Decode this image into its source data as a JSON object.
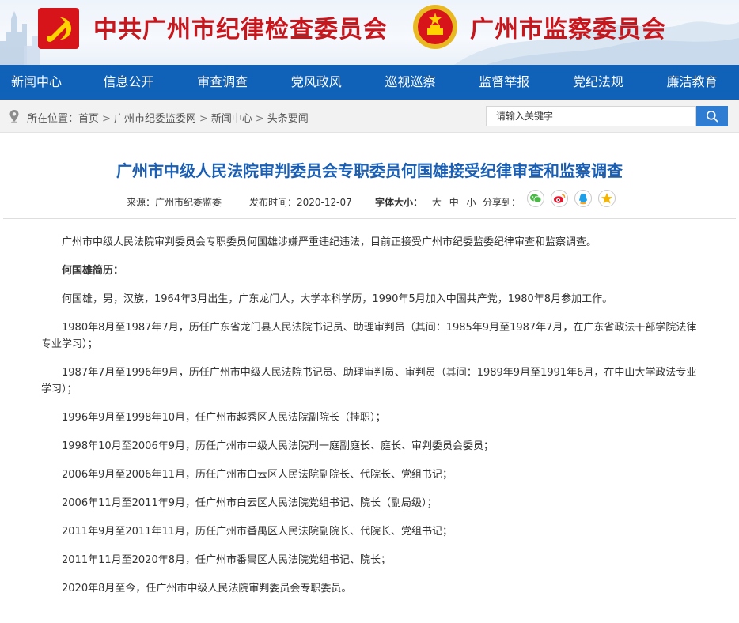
{
  "header": {
    "title_left": "中共广州市纪律检查委员会",
    "title_right": "广州市监察委员会",
    "brand_color": "#c8161d"
  },
  "nav": {
    "items": [
      "新闻中心",
      "信息公开",
      "审查调查",
      "党风政风",
      "巡视巡察",
      "监督举报",
      "党纪法规",
      "廉洁教育"
    ],
    "color": "#1062b8"
  },
  "location": {
    "label": "所在位置：",
    "crumbs": [
      "首页",
      "广州市纪委监委网",
      "新闻中心",
      "头条要闻"
    ],
    "separator": ">"
  },
  "search": {
    "placeholder": "请输入关键字"
  },
  "article": {
    "title": "广州市中级人民法院审判委员会专职委员何国雄接受纪律审查和监察调查",
    "source_label": "来源：",
    "source": "广州市纪委监委",
    "date_label": "发布时间：",
    "date": "2020-12-07",
    "font_size_label": "字体大小：",
    "font_sizes": [
      "大",
      "中",
      "小"
    ],
    "share_label": "分享到：",
    "share_icons": [
      "wechat-icon",
      "weibo-icon",
      "qq-icon",
      "qzone-icon"
    ],
    "paragraphs": [
      "广州市中级人民法院审判委员会专职委员何国雄涉嫌严重违纪违法，目前正接受广州市纪委监委纪律审查和监察调查。",
      "何国雄简历：",
      "何国雄，男，汉族，1964年3月出生，广东龙门人，大学本科学历，1990年5月加入中国共产党，1980年8月参加工作。",
      "1980年8月至1987年7月，历任广东省龙门县人民法院书记员、助理审判员（其间：1985年9月至1987年7月，在广东省政法干部学院法律专业学习）；",
      "1987年7月至1996年9月，历任广州市中级人民法院书记员、助理审判员、审判员（其间：1989年9月至1991年6月，在中山大学政法专业学习）；",
      "1996年9月至1998年10月，任广州市越秀区人民法院副院长（挂职）；",
      "1998年10月至2006年9月，历任广州市中级人民法院刑一庭副庭长、庭长、审判委员会委员；",
      "2006年9月至2006年11月，历任广州市白云区人民法院副院长、代院长、党组书记；",
      "2006年11月至2011年9月，任广州市白云区人民法院党组书记、院长（副局级）；",
      "2011年9月至2011年11月，历任广州市番禺区人民法院副院长、代院长、党组书记；",
      "2011年11月至2020年8月，任广州市番禺区人民法院党组书记、院长；",
      "2020年8月至今，任广州市中级人民法院审判委员会专职委员。"
    ]
  }
}
